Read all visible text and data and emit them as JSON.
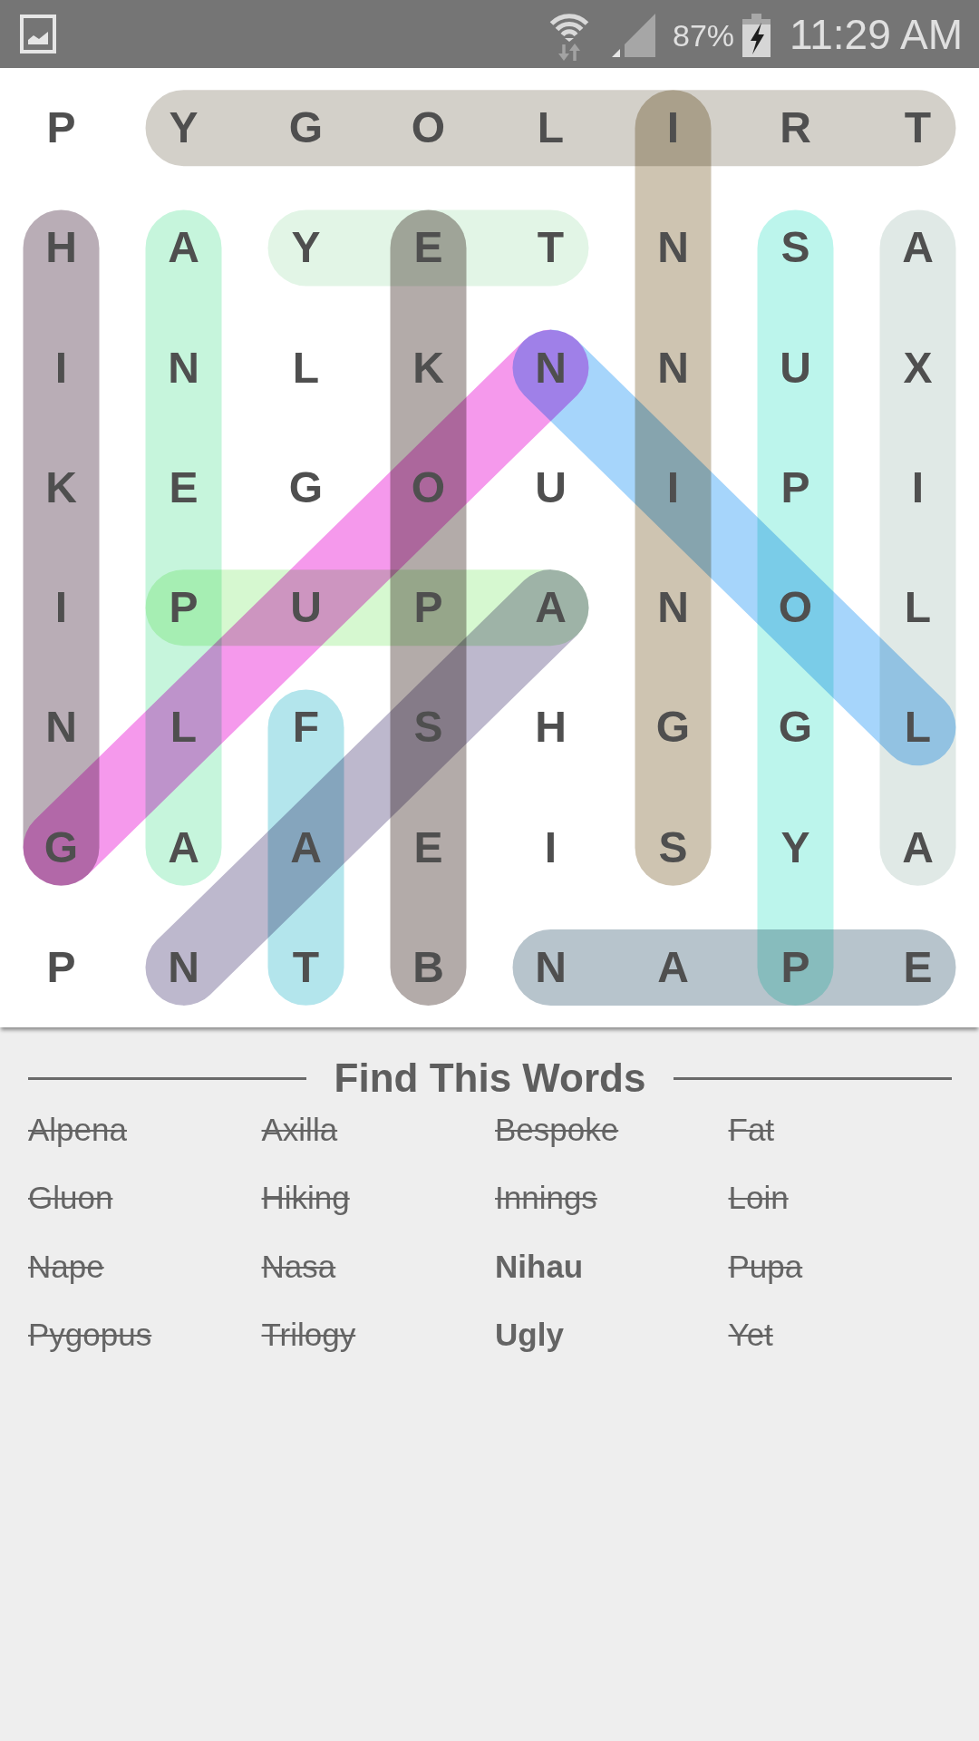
{
  "status_bar": {
    "battery_text": "87%",
    "time": "11:29 AM"
  },
  "grid": {
    "rows": [
      [
        "P",
        "Y",
        "G",
        "O",
        "L",
        "I",
        "R",
        "T"
      ],
      [
        "H",
        "A",
        "Y",
        "E",
        "T",
        "N",
        "S",
        "A"
      ],
      [
        "I",
        "N",
        "L",
        "K",
        "N",
        "N",
        "U",
        "X"
      ],
      [
        "K",
        "E",
        "G",
        "O",
        "U",
        "I",
        "P",
        "I"
      ],
      [
        "I",
        "P",
        "U",
        "P",
        "A",
        "N",
        "O",
        "L"
      ],
      [
        "N",
        "L",
        "F",
        "S",
        "H",
        "G",
        "G",
        "L"
      ],
      [
        "G",
        "A",
        "A",
        "E",
        "I",
        "S",
        "Y",
        "A"
      ],
      [
        "P",
        "N",
        "T",
        "B",
        "N",
        "A",
        "P",
        "E"
      ]
    ],
    "highlights": [
      {
        "color": "#d3d0c9"
      },
      {
        "color": "#b9adb6"
      },
      {
        "color": "#c6f5dc"
      },
      {
        "color": "#e2f5e6"
      },
      {
        "color": "#b3aba9"
      },
      {
        "color": "#cec4b1"
      },
      {
        "color": "#bcf5ec"
      },
      {
        "color": "#e0e9e6"
      },
      {
        "color": "#d6f8d0"
      },
      {
        "color": "#b3e5ec"
      },
      {
        "color": "#b7c4cc"
      },
      {
        "color": "#f599ec"
      },
      {
        "color": "#a6d5fb"
      },
      {
        "color": "#bdb8cd"
      }
    ]
  },
  "word_list": {
    "title": "Find This Words",
    "words": [
      {
        "text": "Alpena",
        "found": true
      },
      {
        "text": "Axilla",
        "found": true
      },
      {
        "text": "Bespoke",
        "found": true
      },
      {
        "text": "Fat",
        "found": true
      },
      {
        "text": "Gluon",
        "found": true
      },
      {
        "text": "Hiking",
        "found": true
      },
      {
        "text": "Innings",
        "found": true
      },
      {
        "text": "Loin",
        "found": true
      },
      {
        "text": "Nape",
        "found": true
      },
      {
        "text": "Nasa",
        "found": true
      },
      {
        "text": "Nihau",
        "found": false
      },
      {
        "text": "Pupa",
        "found": true
      },
      {
        "text": "Pygopus",
        "found": true
      },
      {
        "text": "Trilogy",
        "found": true
      },
      {
        "text": "Ugly",
        "found": false
      },
      {
        "text": "Yet",
        "found": true
      }
    ]
  }
}
